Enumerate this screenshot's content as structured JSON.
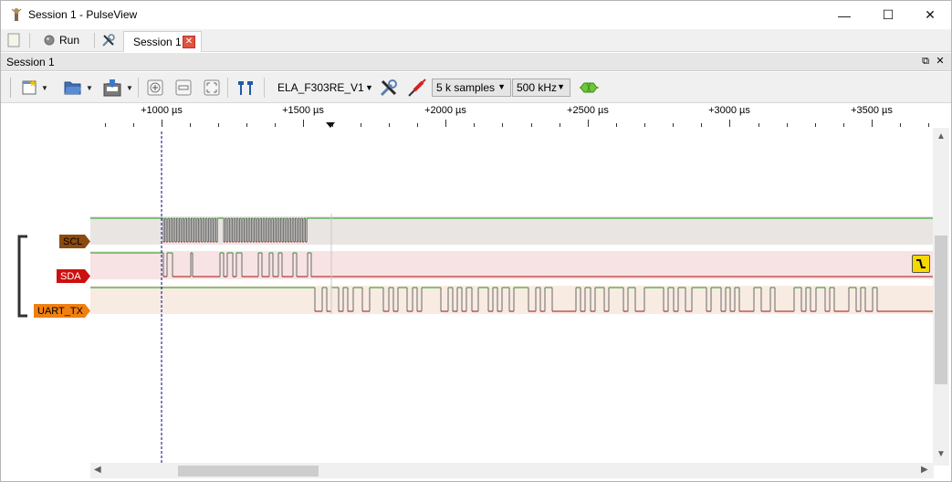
{
  "window": {
    "title": "Session 1 - PulseView",
    "controls": {
      "minimize": "—",
      "maximize": "☐",
      "close": "✕"
    }
  },
  "menubar": {
    "run_label": "Run",
    "tab_label": "Session 1"
  },
  "session": {
    "title": "Session 1"
  },
  "toolbar": {
    "device": "ELA_F303RE_V1",
    "samples": "5 k samples",
    "rate": "500 kHz"
  },
  "ruler": {
    "labels": [
      "+1000 µs",
      "+1500 µs",
      "+2000 µs",
      "+2500 µs",
      "+3000 µs",
      "+3500 µs"
    ]
  },
  "signals": [
    {
      "name": "SCL",
      "color": "#8b4a10"
    },
    {
      "name": "SDA",
      "color": "#cc1010"
    },
    {
      "name": "UART_TX",
      "color": "#f08010"
    }
  ],
  "colors": {
    "trace_high": "#1a9a1a",
    "trace_low": "#a01010",
    "cursor": "#00008b"
  }
}
